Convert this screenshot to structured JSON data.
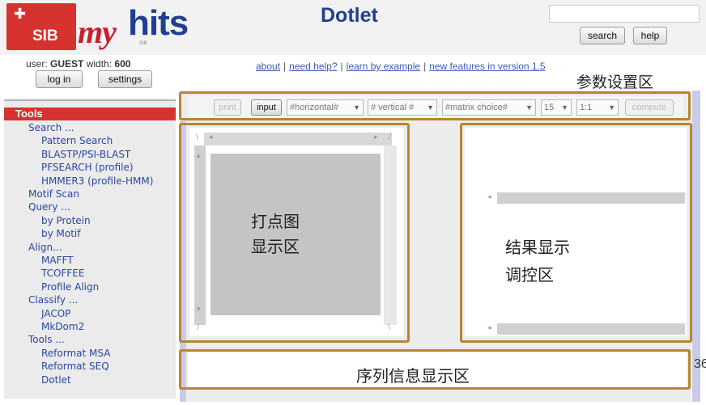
{
  "header": {
    "logo_sib": "SIB",
    "logo_my": "my",
    "logo_hits": "hits",
    "logo_sub": "SIB",
    "title": "Dotlet",
    "search_value": "",
    "search_button": "search",
    "help_button": "help"
  },
  "user": {
    "user_label": "user:",
    "user_name": "GUEST",
    "width_label": "width:",
    "width_value": "600",
    "login_button": "log in",
    "settings_button": "settings"
  },
  "nav": {
    "links": [
      "about",
      "need help?",
      "learn by example",
      "new features in version 1.5"
    ]
  },
  "sidebar": {
    "header": "Tools",
    "items": [
      {
        "label": "Search ...",
        "level": 1
      },
      {
        "label": "Pattern Search",
        "level": 2
      },
      {
        "label": "BLASTP/PSI-BLAST",
        "level": 2
      },
      {
        "label": "PFSEARCH (profile)",
        "level": 2
      },
      {
        "label": "HMMER3 (profile-HMM)",
        "level": 2
      },
      {
        "label": "Motif Scan",
        "level": 1
      },
      {
        "label": "Query ...",
        "level": 1
      },
      {
        "label": "by Protein",
        "level": 2
      },
      {
        "label": "by Motif",
        "level": 2
      },
      {
        "label": "Align...",
        "level": 1
      },
      {
        "label": "MAFFT",
        "level": 2
      },
      {
        "label": "TCOFFEE",
        "level": 2
      },
      {
        "label": "Profile Align",
        "level": 2
      },
      {
        "label": "Classify ...",
        "level": 1
      },
      {
        "label": "JACOP",
        "level": 2
      },
      {
        "label": "MkDom2",
        "level": 2
      },
      {
        "label": "Tools ...",
        "level": 1
      },
      {
        "label": "Reformat MSA",
        "level": 2
      },
      {
        "label": "Reformat SEQ",
        "level": 2
      },
      {
        "label": "Dotlet",
        "level": 2
      }
    ]
  },
  "toolbar": {
    "print": "print",
    "input": "input",
    "horizontal": "#horizontal#",
    "vertical": "# vertical #",
    "matrix": "#matrix choice#",
    "window": "15",
    "zoom": "1:1",
    "compute": "compute"
  },
  "info": {
    "truncated_number": "36"
  },
  "annotations": {
    "params_area": "参数设置区",
    "dotplot_line1": "打点图",
    "dotplot_line2": "显示区",
    "result_line1": "结果显示",
    "result_line2": "调控区",
    "info_area": "序列信息显示区"
  },
  "colors": {
    "brand_red": "#d6322f",
    "brand_blue": "#1f3f8f",
    "link_blue": "#3a5bb0",
    "annotation_border": "#b8862f",
    "side_strip": "#c9cbe9"
  }
}
